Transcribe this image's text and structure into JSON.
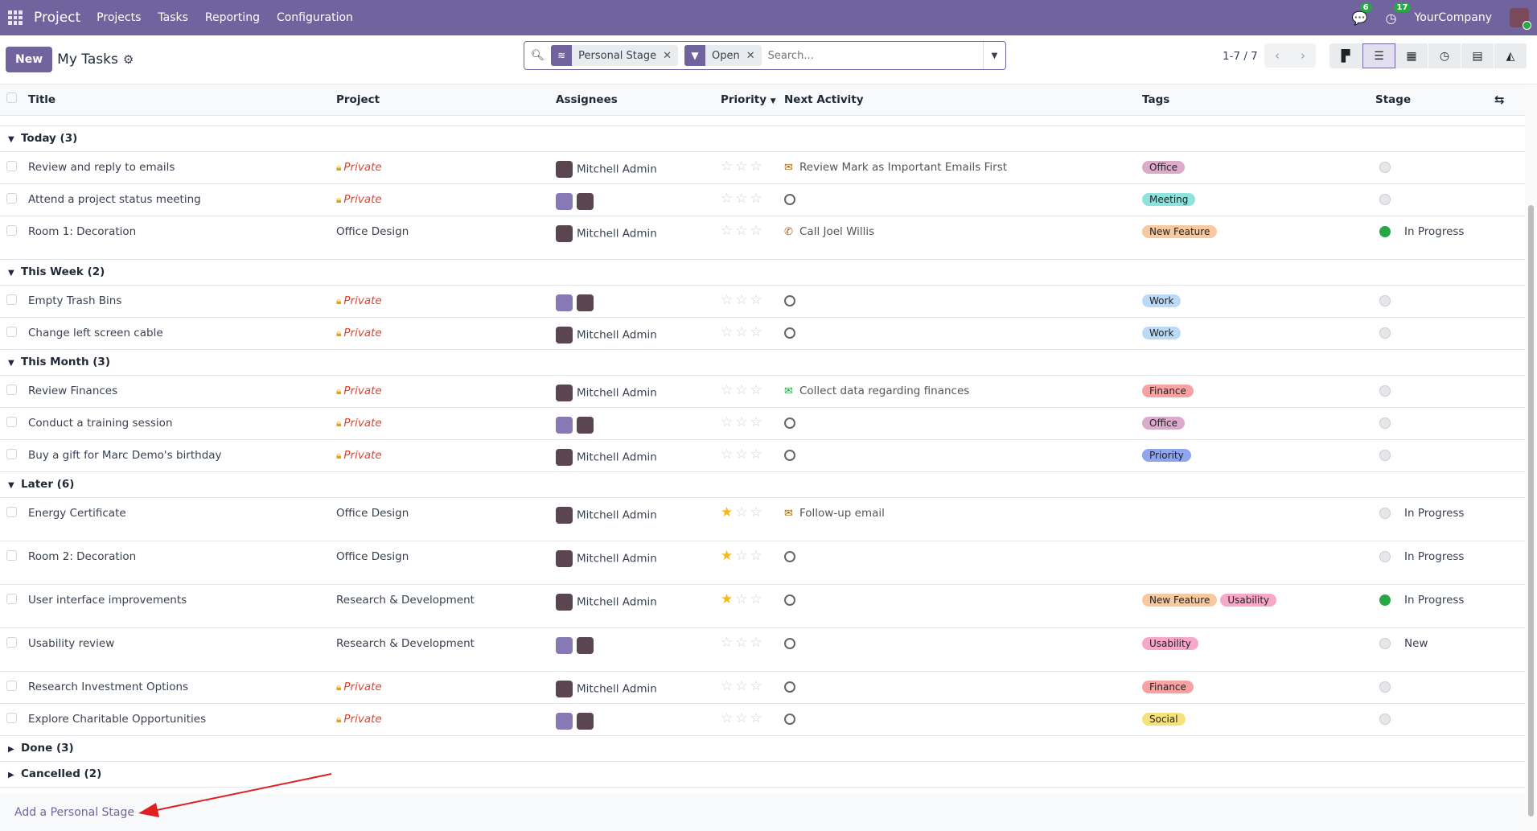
{
  "nav": {
    "brand": "Project",
    "menu": [
      "Projects",
      "Tasks",
      "Reporting",
      "Configuration"
    ],
    "messages_count": "6",
    "activities_count": "17",
    "company": "YourCompany"
  },
  "control": {
    "new_label": "New",
    "title": "My Tasks",
    "facets": [
      "Personal Stage",
      "Open"
    ],
    "search_placeholder": "Search...",
    "pager": "1-7 / 7"
  },
  "columns": [
    "Title",
    "Project",
    "Assignees",
    "Priority",
    "Next Activity",
    "Tags",
    "Stage"
  ],
  "colors": {
    "accent": "#71639e",
    "private": "#e3422b",
    "in_progress": "#28a745"
  },
  "tag_colors": {
    "Office": "#dcaacb",
    "Meeting": "#8fe3dc",
    "New Feature": "#f7c9a0",
    "Work": "#bcdaf5",
    "Finance": "#f7a3a3",
    "Priority": "#8fa6ee",
    "Usability": "#f7a8c8",
    "Social": "#f5e27a"
  },
  "groups": [
    {
      "label": "Today (3)",
      "open": true,
      "rows": [
        {
          "title": "Review and reply to emails",
          "project": "Private",
          "private": true,
          "assignee": "Mitchell Admin",
          "stars": 0,
          "activity": {
            "icon": "email-icon",
            "text": "Review Mark as Important Emails First",
            "color": "#a0661a"
          },
          "tags": [
            "Office"
          ],
          "stage": "",
          "dot": "gray"
        },
        {
          "title": "Attend a project status meeting",
          "project": "Private",
          "private": true,
          "assignee": "",
          "stars": 0,
          "activity": {
            "icon": "clock-icon",
            "text": ""
          },
          "tags": [
            "Meeting"
          ],
          "stage": "",
          "dot": "gray"
        },
        {
          "title": "Room 1: Decoration",
          "project": "Office Design",
          "private": false,
          "assignee": "Mitchell Admin",
          "stars": 0,
          "activity": {
            "icon": "phone-icon",
            "text": "Call Joel Willis",
            "color": "#a0661a"
          },
          "tags": [
            "New Feature"
          ],
          "stage": "In Progress",
          "dot": "green",
          "tall": true
        }
      ]
    },
    {
      "label": "This Week (2)",
      "open": true,
      "rows": [
        {
          "title": "Empty Trash Bins",
          "project": "Private",
          "private": true,
          "assignee": "",
          "stars": 0,
          "activity": {
            "icon": "clock-icon",
            "text": ""
          },
          "tags": [
            "Work"
          ],
          "stage": "",
          "dot": "gray"
        },
        {
          "title": "Change left screen cable",
          "project": "Private",
          "private": true,
          "assignee": "Mitchell Admin",
          "stars": 0,
          "activity": {
            "icon": "clock-icon",
            "text": ""
          },
          "tags": [
            "Work"
          ],
          "stage": "",
          "dot": "gray"
        }
      ]
    },
    {
      "label": "This Month (3)",
      "open": true,
      "rows": [
        {
          "title": "Review Finances",
          "project": "Private",
          "private": true,
          "assignee": "Mitchell Admin",
          "stars": 0,
          "activity": {
            "icon": "email-icon",
            "text": "Collect data regarding finances",
            "color": "#28a745"
          },
          "tags": [
            "Finance"
          ],
          "stage": "",
          "dot": "gray"
        },
        {
          "title": "Conduct a training session",
          "project": "Private",
          "private": true,
          "assignee": "",
          "stars": 0,
          "activity": {
            "icon": "clock-icon",
            "text": ""
          },
          "tags": [
            "Office"
          ],
          "stage": "",
          "dot": "gray"
        },
        {
          "title": "Buy a gift for Marc Demo's birthday",
          "project": "Private",
          "private": true,
          "assignee": "Mitchell Admin",
          "stars": 0,
          "activity": {
            "icon": "clock-icon",
            "text": ""
          },
          "tags": [
            "Priority"
          ],
          "stage": "",
          "dot": "gray"
        }
      ]
    },
    {
      "label": "Later (6)",
      "open": true,
      "rows": [
        {
          "title": "Energy Certificate",
          "project": "Office Design",
          "private": false,
          "assignee": "Mitchell Admin",
          "stars": 1,
          "activity": {
            "icon": "email-icon",
            "text": "Follow-up email",
            "color": "#a0661a"
          },
          "tags": [],
          "stage": "In Progress",
          "dot": "gray",
          "tall": true
        },
        {
          "title": "Room 2: Decoration",
          "project": "Office Design",
          "private": false,
          "assignee": "Mitchell Admin",
          "stars": 1,
          "activity": {
            "icon": "clock-icon",
            "text": ""
          },
          "tags": [],
          "stage": "In Progress",
          "dot": "gray",
          "tall": true
        },
        {
          "title": "User interface improvements",
          "project": "Research & Development",
          "private": false,
          "assignee": "Mitchell Admin",
          "stars": 1,
          "activity": {
            "icon": "clock-icon",
            "text": ""
          },
          "tags": [
            "New Feature",
            "Usability"
          ],
          "stage": "In Progress",
          "dot": "green",
          "tall": true
        },
        {
          "title": "Usability review",
          "project": "Research & Development",
          "private": false,
          "assignee": "",
          "stars": 0,
          "activity": {
            "icon": "clock-icon",
            "text": ""
          },
          "tags": [
            "Usability"
          ],
          "stage": "New",
          "dot": "gray",
          "tall": true
        },
        {
          "title": "Research Investment Options",
          "project": "Private",
          "private": true,
          "assignee": "Mitchell Admin",
          "stars": 0,
          "activity": {
            "icon": "clock-icon",
            "text": ""
          },
          "tags": [
            "Finance"
          ],
          "stage": "",
          "dot": "gray"
        },
        {
          "title": "Explore Charitable Opportunities",
          "project": "Private",
          "private": true,
          "assignee": "",
          "stars": 0,
          "activity": {
            "icon": "clock-icon",
            "text": ""
          },
          "tags": [
            "Social"
          ],
          "stage": "",
          "dot": "gray"
        }
      ]
    },
    {
      "label": "Done (3)",
      "open": false,
      "rows": []
    },
    {
      "label": "Cancelled (2)",
      "open": false,
      "rows": []
    }
  ],
  "footer": {
    "add_stage": "Add a Personal Stage"
  }
}
